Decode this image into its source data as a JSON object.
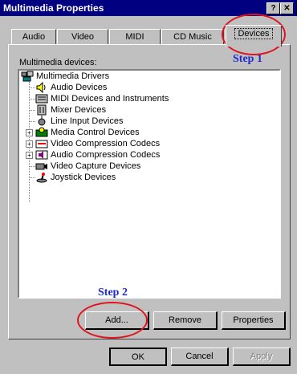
{
  "window": {
    "title": "Multimedia Properties",
    "help_label": "?",
    "close_label": "✕"
  },
  "tabs": [
    {
      "label": "Audio"
    },
    {
      "label": "Video"
    },
    {
      "label": "MIDI"
    },
    {
      "label": "CD Music"
    },
    {
      "label": "Devices",
      "active": true
    }
  ],
  "annotations": {
    "step1": "Step 1",
    "step2": "Step 2",
    "ellipse_color": "#e0141e",
    "step_color": "#1e28d2"
  },
  "devices": {
    "label": "Multimedia devices:",
    "root": "Multimedia Drivers",
    "items": [
      {
        "label": "Audio Devices",
        "icon": "speaker-icon",
        "expandable": false
      },
      {
        "label": "MIDI Devices and Instruments",
        "icon": "keyboard-icon",
        "expandable": false
      },
      {
        "label": "Mixer Devices",
        "icon": "mixer-icon",
        "expandable": false
      },
      {
        "label": "Line Input Devices",
        "icon": "line-input-icon",
        "expandable": false
      },
      {
        "label": "Media Control Devices",
        "icon": "media-control-icon",
        "expandable": true
      },
      {
        "label": "Video Compression Codecs",
        "icon": "video-codec-icon",
        "expandable": true
      },
      {
        "label": "Audio Compression Codecs",
        "icon": "audio-codec-icon",
        "expandable": true
      },
      {
        "label": "Video Capture Devices",
        "icon": "video-capture-icon",
        "expandable": false
      },
      {
        "label": "Joystick Devices",
        "icon": "joystick-icon",
        "expandable": false
      }
    ]
  },
  "buttons": {
    "add": "Add...",
    "remove": "Remove",
    "properties": "Properties",
    "ok": "OK",
    "cancel": "Cancel",
    "apply": "Apply"
  }
}
